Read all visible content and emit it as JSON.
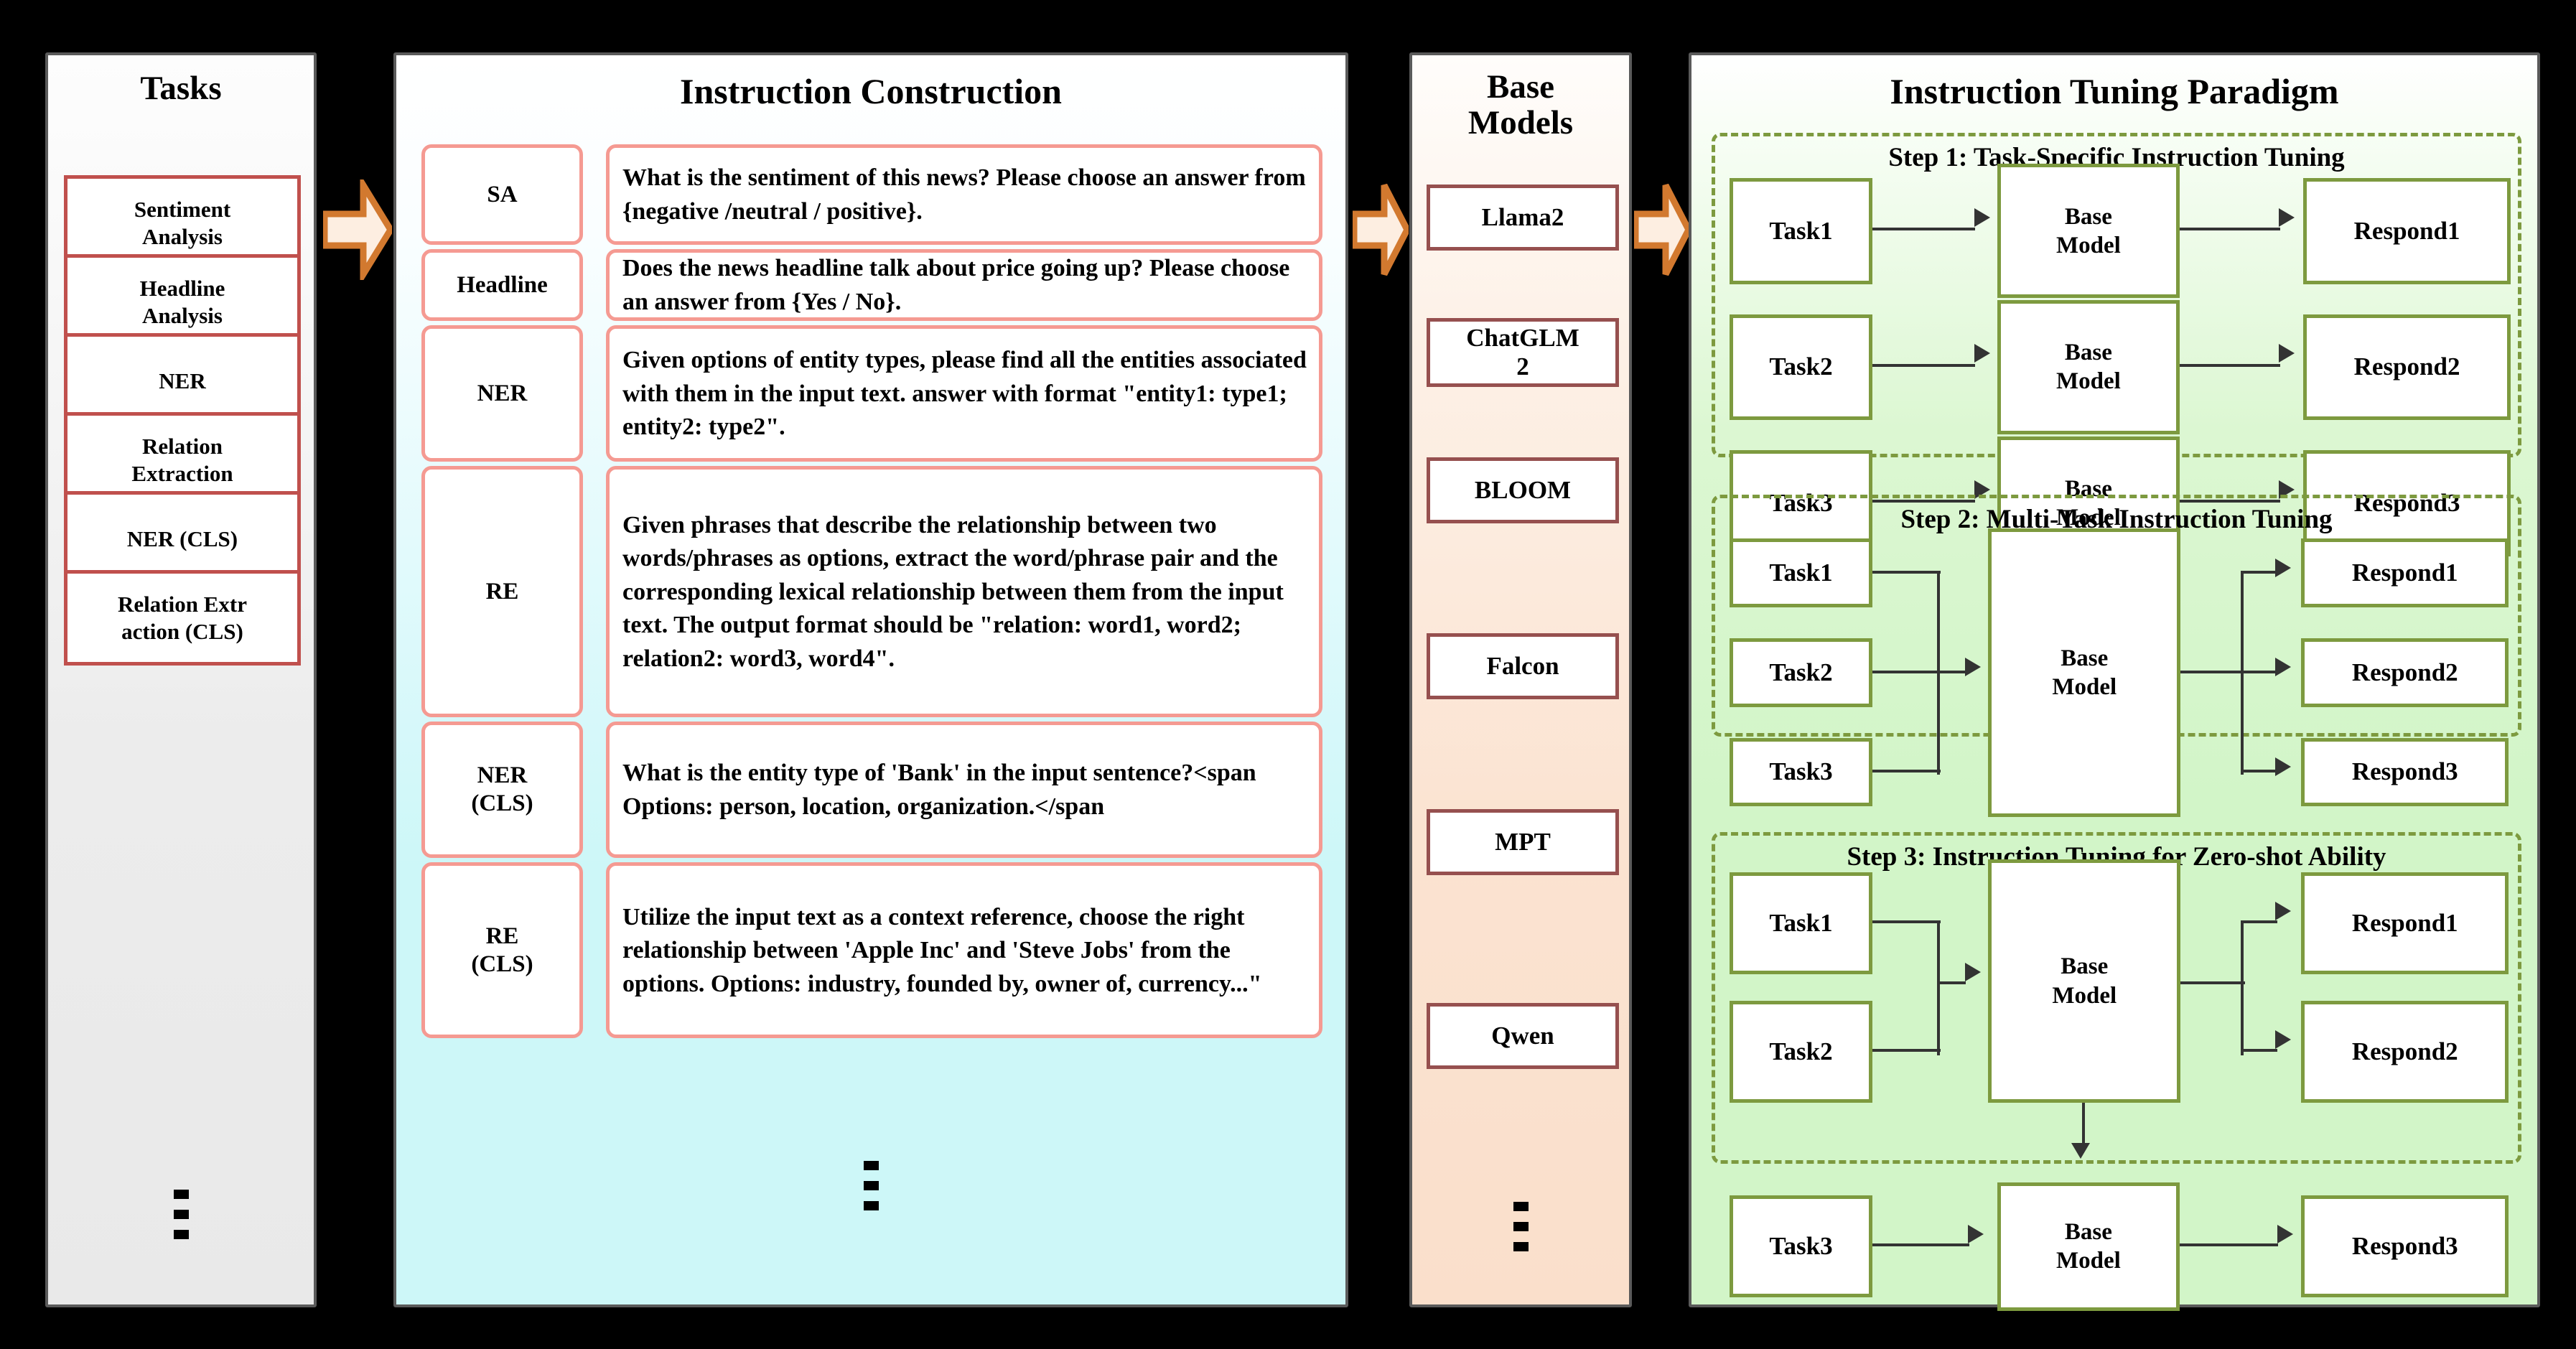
{
  "tasks": {
    "title": "Tasks",
    "items": [
      {
        "label": "Sentiment\nAnalysis"
      },
      {
        "label": "Headline\nAnalysis"
      },
      {
        "label": "NER"
      },
      {
        "label": "Relation\nExtraction"
      },
      {
        "label": "NER (CLS)"
      },
      {
        "label": "Relation Extr\naction (CLS)"
      }
    ],
    "ellipsis": "vertical-ellipsis"
  },
  "instruction": {
    "title": "Instruction Construction",
    "rows": [
      {
        "label": "SA",
        "text": "What is the sentiment of this news? Please choose an answer from {negative /neutral / positive}."
      },
      {
        "label": "Headline",
        "text": "Does the news headline talk about price going up? Please choose an answer from {Yes / No}."
      },
      {
        "label": "NER",
        "text": "Given options of entity types, please find all the entities associated with them in the input text. answer with format \"entity1: type1; entity2: type2\"."
      },
      {
        "label": "RE",
        "text": "Given phrases that describe the relationship between two words/phrases as options, extract the word/phrase pair and the corresponding lexical relationship between them from the input text. The output format should be \"relation: word1, word2; relation2: word3, word4\"."
      },
      {
        "label": "NER\n(CLS)",
        "text": "What is the entity type of 'Bank' in the input sentence?<span Options: person, location, organization.</span"
      },
      {
        "label": "RE\n(CLS)",
        "text": "Utilize the input text as a context reference, choose the right relationship between 'Apple Inc' and 'Steve Jobs' from the options. Options: industry, founded by, owner of, currency...\""
      }
    ],
    "ellipsis": "vertical-ellipsis"
  },
  "base_models": {
    "title": "Base\nModels",
    "items": [
      "Llama2",
      "ChatGLM\n2",
      "BLOOM",
      "Falcon",
      "MPT",
      "Qwen"
    ],
    "ellipsis": "vertical-ellipsis"
  },
  "paradigm": {
    "title": "Instruction Tuning Paradigm",
    "steps": [
      {
        "title": "Step 1: Task-Specific Instruction Tuning",
        "tasks": [
          "Task1",
          "Task2",
          "Task3"
        ],
        "models": [
          "Base\nModel",
          "Base\nModel",
          "Base\nModel"
        ],
        "responses": [
          "Respond1",
          "Respond2",
          "Respond3"
        ]
      },
      {
        "title": "Step 2: Multi-Task Instruction Tuning",
        "tasks": [
          "Task1",
          "Task2",
          "Task3"
        ],
        "models": [
          "Base\nModel"
        ],
        "responses": [
          "Respond1",
          "Respond2",
          "Respond3"
        ]
      },
      {
        "title": "Step 3: Instruction Tuning for Zero-shot Ability",
        "tasks": [
          "Task1",
          "Task2",
          "Task3"
        ],
        "models": [
          "Base\nModel",
          "Base\nModel"
        ],
        "responses": [
          "Respond1",
          "Respond2",
          "Respond3"
        ]
      }
    ]
  },
  "flow_arrows": [
    {
      "name": "tasks-to-instruction"
    },
    {
      "name": "instruction-to-models"
    },
    {
      "name": "models-to-paradigm"
    }
  ],
  "colors": {
    "task_border": "#c0504d",
    "instruction_border": "#f59a92",
    "instruction_bg": "#cdf7f8",
    "model_border": "#96504f",
    "model_bg": "#fadfcb",
    "paradigm_border": "#7d9a3f",
    "paradigm_bg": "#d2f5c8",
    "arrow_fill": "#fdeee1",
    "arrow_stroke": "#d2792f",
    "panel_border": "#5a5a5a"
  }
}
